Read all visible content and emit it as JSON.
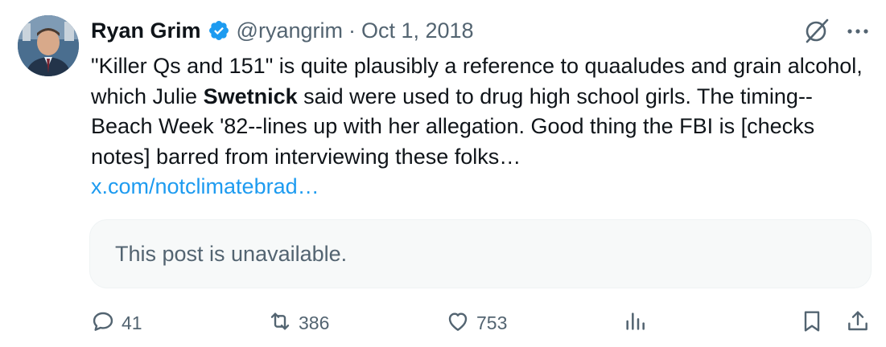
{
  "author": {
    "name": "Ryan Grim",
    "handle": "@ryangrim",
    "separator": "·",
    "date": "Oct 1, 2018"
  },
  "tweet": {
    "text_parts": [
      "\"Killer Qs and 151\" is quite plausibly a reference to quaaludes and grain alcohol, which Julie ",
      "Swetnick",
      " said were used to drug high school girls. The timing--Beach Week '82--lines up with her allegation. Good thing the FBI is [checks notes] barred from interviewing these folks…"
    ],
    "link": "x.com/notclimatebrad…"
  },
  "quote": {
    "unavailable_text": "This post is unavailable."
  },
  "actions": {
    "replies": "41",
    "reposts": "386",
    "likes": "753"
  },
  "colors": {
    "accent": "#1d9bf0",
    "secondary_text": "#536471",
    "primary_text": "#0f1419",
    "card_bg": "#f7f9f9"
  },
  "icons": [
    "verified-badge-icon",
    "grok-icon",
    "more-icon",
    "reply-icon",
    "repost-icon",
    "like-icon",
    "views-icon",
    "bookmark-icon",
    "share-icon"
  ]
}
